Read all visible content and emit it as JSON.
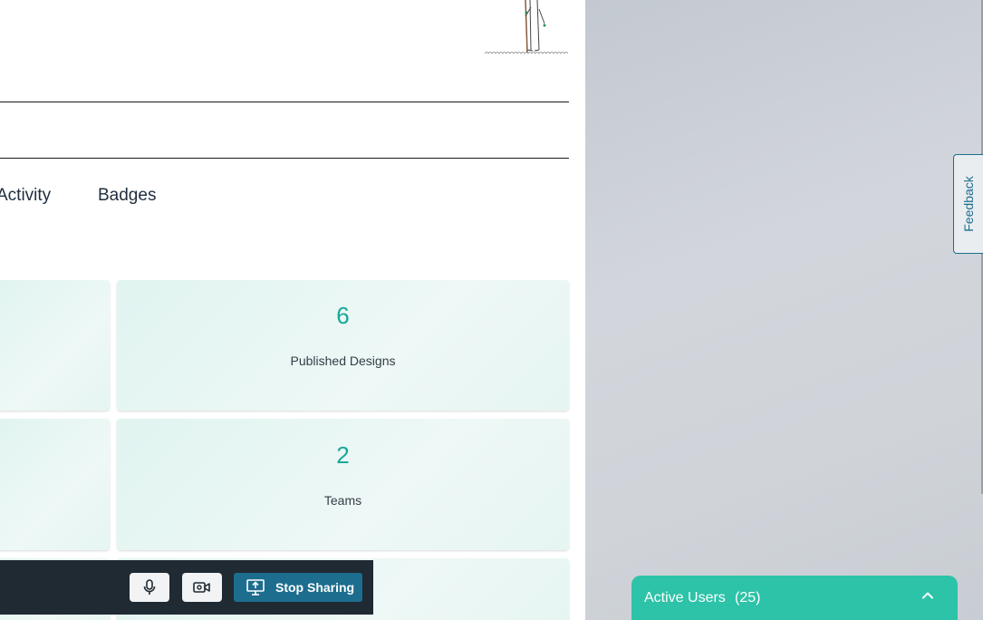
{
  "tabs": [
    {
      "label": "Activity"
    },
    {
      "label": "Badges"
    }
  ],
  "stats": [
    {
      "number": "6",
      "label": "Published Designs"
    },
    {
      "number": "2",
      "label": "Teams"
    }
  ],
  "call_controls": {
    "stop_sharing_label": "Stop Sharing"
  },
  "feedback": {
    "label": "Feedback"
  },
  "active_users": {
    "label": "Active Users",
    "count": "(25)"
  },
  "colors": {
    "accent": "#17a89a",
    "active_users_bg": "#2dc3a8",
    "stop_sharing_bg": "#1d6d8e",
    "call_bar_bg": "#1f2a33"
  },
  "icons": {
    "microphone": "microphone-icon",
    "camera": "video-camera-icon",
    "screen_share": "screen-share-icon",
    "chevron": "chevron-up-icon"
  }
}
